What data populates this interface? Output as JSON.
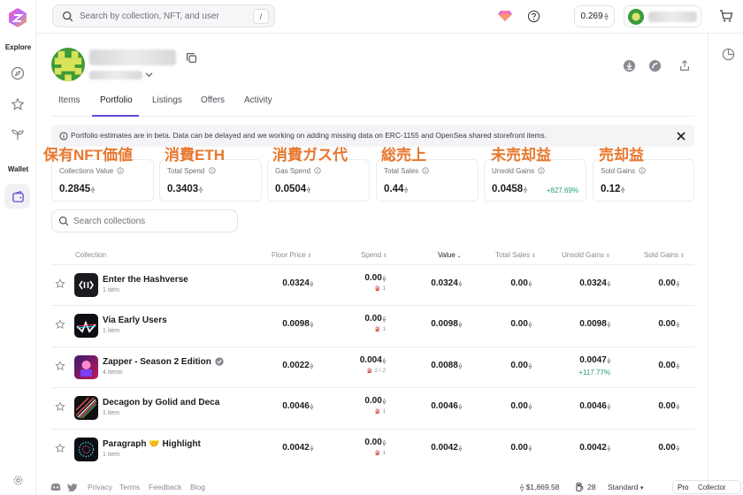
{
  "search": {
    "placeholder": "Search by collection, NFT, and user",
    "shortcut": "/"
  },
  "header": {
    "balance": "0.269",
    "eth_symbol": "⟠"
  },
  "sidebar": {
    "explore_label": "Explore",
    "wallet_label": "Wallet"
  },
  "profile": {
    "tabs": [
      "Items",
      "Portfolio",
      "Listings",
      "Offers",
      "Activity"
    ],
    "active_tab": "Portfolio"
  },
  "banner": {
    "text": "Portfolio estimates are in beta. Data can be delayed and we working on adding missing data on ERC-1155 and OpenSea shared storefront items."
  },
  "annotations": [
    "保有NFT価値",
    "消費ETH",
    "消費ガス代",
    "総売上",
    "未売却益",
    "売却益"
  ],
  "stats": [
    {
      "label": "Collections Value",
      "value": "0.2845",
      "change": ""
    },
    {
      "label": "Total Spend",
      "value": "0.3403",
      "change": ""
    },
    {
      "label": "Gas Spend",
      "value": "0.0504",
      "change": ""
    },
    {
      "label": "Total Sales",
      "value": "0.44",
      "change": ""
    },
    {
      "label": "Unsold Gains",
      "value": "0.0458",
      "change": "+827.69%"
    },
    {
      "label": "Sold Gains",
      "value": "0.12",
      "change": ""
    }
  ],
  "collections_search": {
    "placeholder": "Search collections"
  },
  "table": {
    "headers": [
      "Collection",
      "Floor Price",
      "Spend",
      "Value",
      "Total Sales",
      "Unsold Gains",
      "Sold Gains"
    ],
    "sorted_by": "Value",
    "rows": [
      {
        "name": "Enter the Hashverse",
        "items": "1 item",
        "floor": "0.0324",
        "spend": "0.00",
        "spend_sub": "1",
        "value": "0.0324",
        "total_sales": "0.00",
        "unsold": "0.0324",
        "unsold_pct": "",
        "sold": "0.00"
      },
      {
        "name": "Via Early Users",
        "items": "1 item",
        "floor": "0.0098",
        "spend": "0.00",
        "spend_sub": "1",
        "value": "0.0098",
        "total_sales": "0.00",
        "unsold": "0.0098",
        "unsold_pct": "",
        "sold": "0.00"
      },
      {
        "name": "Zapper - Season 2 Edition",
        "items": "4 items",
        "floor": "0.0022",
        "spend": "0.004",
        "spend_sub": "2 / 2",
        "value": "0.0088",
        "total_sales": "0.00",
        "unsold": "0.0047",
        "unsold_pct": "+117.77%",
        "sold": "0.00"
      },
      {
        "name": "Decagon by Golid and Deca",
        "items": "1 item",
        "floor": "0.0046",
        "spend": "0.00",
        "spend_sub": "1",
        "value": "0.0046",
        "total_sales": "0.00",
        "unsold": "0.0046",
        "unsold_pct": "",
        "sold": "0.00"
      },
      {
        "name": "Paragraph 🤝 Highlight",
        "items": "1 item",
        "floor": "0.0042",
        "spend": "0.00",
        "spend_sub": "1",
        "value": "0.0042",
        "total_sales": "0.00",
        "unsold": "0.0042",
        "unsold_pct": "",
        "sold": "0.00"
      }
    ]
  },
  "footer": {
    "links": [
      "Privacy",
      "Terms",
      "Feedback",
      "Blog"
    ],
    "eth_price": "$1,869.58",
    "gas": "28",
    "gas_mode": "Standard",
    "pro_label": "Pro",
    "collector_label": "Collector"
  },
  "colors": {
    "accent": "#5b4ddb",
    "positive": "#22a06b",
    "annotation": "#e8772e"
  }
}
